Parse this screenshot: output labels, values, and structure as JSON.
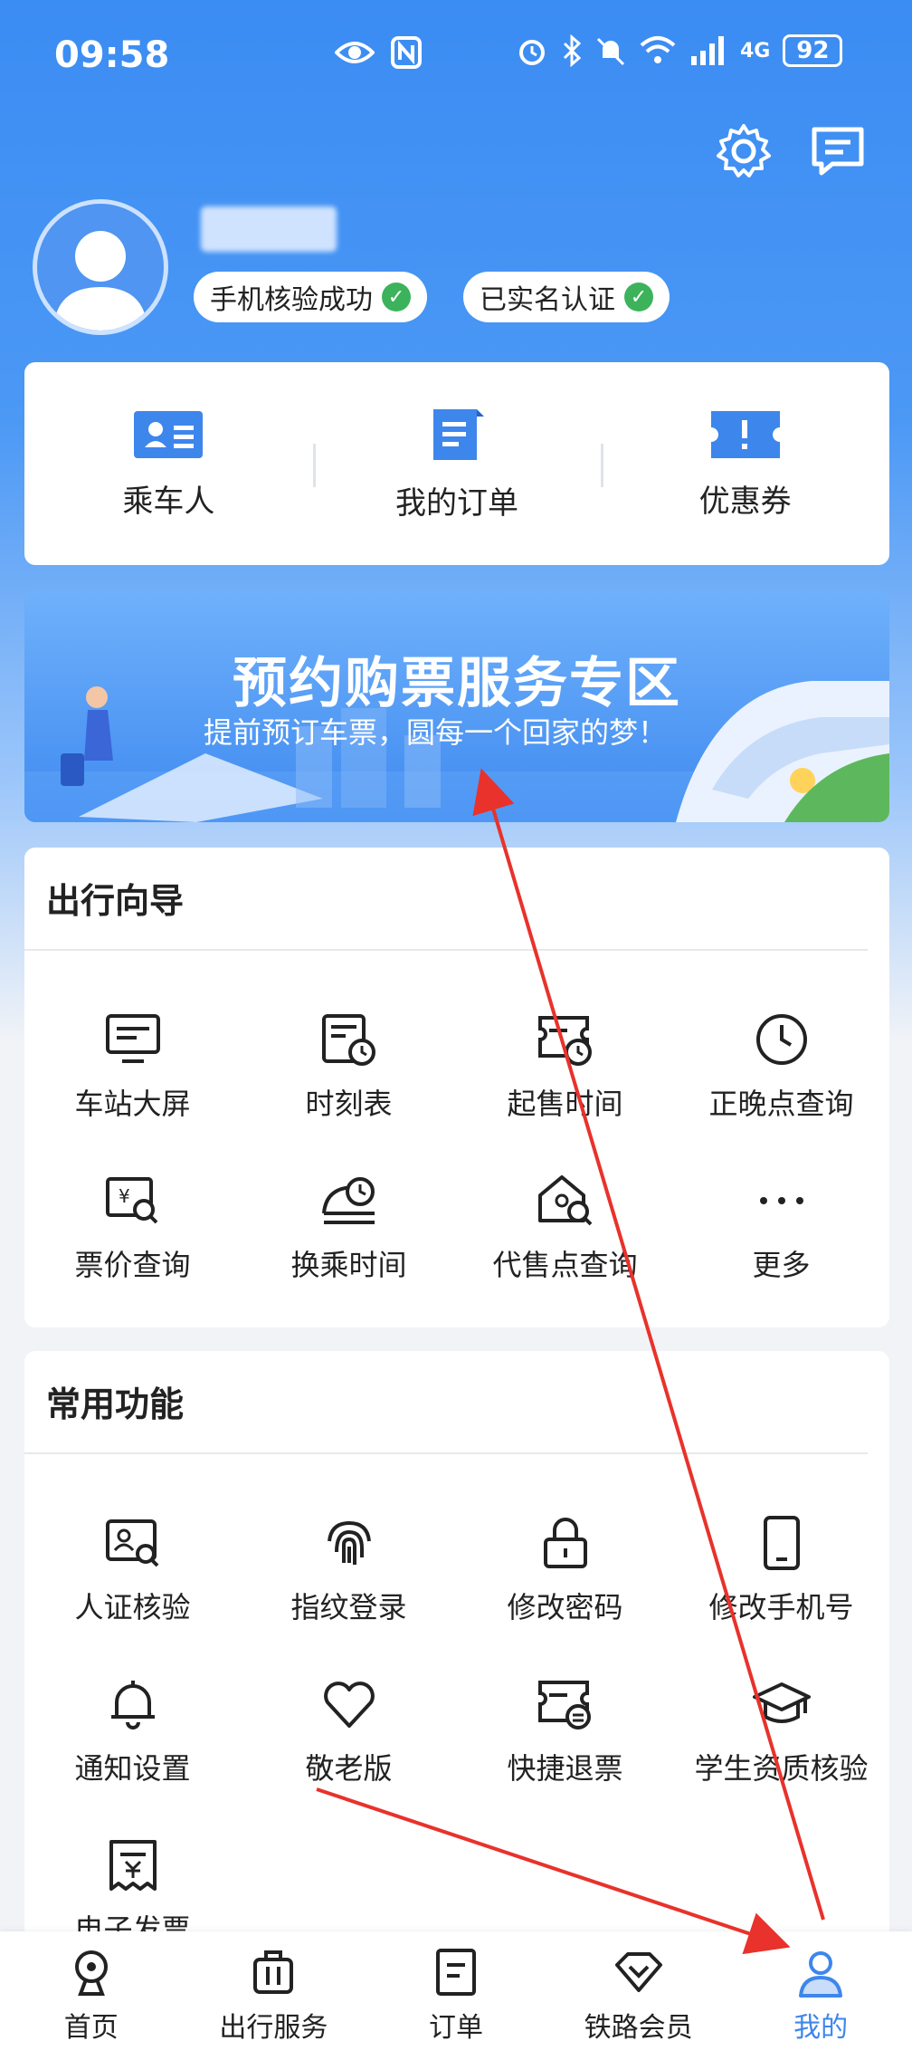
{
  "status_bar": {
    "time": "09:58",
    "battery": "92",
    "network": "4G"
  },
  "profile": {
    "badge_phone": "手机核验成功",
    "badge_realname": "已实名认证"
  },
  "quick": [
    {
      "label": "乘车人",
      "icon": "id-card-icon"
    },
    {
      "label": "我的订单",
      "icon": "document-icon"
    },
    {
      "label": "优惠券",
      "icon": "coupon-icon"
    }
  ],
  "banner": {
    "title": "预约购票服务专区",
    "subtitle": "提前预订车票，圆每一个回家的梦！"
  },
  "travel_guide": {
    "title": "出行向导",
    "items": [
      {
        "label": "车站大屏",
        "icon": "monitor-icon"
      },
      {
        "label": "时刻表",
        "icon": "timetable-icon"
      },
      {
        "label": "起售时间",
        "icon": "ticket-clock-icon"
      },
      {
        "label": "正晚点查询",
        "icon": "clock-icon"
      },
      {
        "label": "票价查询",
        "icon": "price-search-icon"
      },
      {
        "label": "换乘时间",
        "icon": "train-clock-icon"
      },
      {
        "label": "代售点查询",
        "icon": "house-search-icon"
      },
      {
        "label": "更多",
        "icon": "more-icon"
      }
    ]
  },
  "common_functions": {
    "title": "常用功能",
    "items": [
      {
        "label": "人证核验",
        "icon": "id-verify-icon"
      },
      {
        "label": "指纹登录",
        "icon": "fingerprint-icon"
      },
      {
        "label": "修改密码",
        "icon": "lock-icon"
      },
      {
        "label": "修改手机号",
        "icon": "phone-icon"
      },
      {
        "label": "通知设置",
        "icon": "bell-icon"
      },
      {
        "label": "敬老版",
        "icon": "heart-icon"
      },
      {
        "label": "快捷退票",
        "icon": "refund-ticket-icon"
      },
      {
        "label": "学生资质核验",
        "icon": "graduation-cap-icon"
      },
      {
        "label": "电子发票",
        "icon": "invoice-icon"
      }
    ]
  },
  "tabbar": [
    {
      "label": "首页",
      "icon": "home-icon"
    },
    {
      "label": "出行服务",
      "icon": "luggage-icon"
    },
    {
      "label": "订单",
      "icon": "order-icon"
    },
    {
      "label": "铁路会员",
      "icon": "diamond-icon"
    },
    {
      "label": "我的",
      "icon": "user-icon",
      "active": true
    }
  ],
  "colors": {
    "primary": "#3d86ec",
    "success": "#3cb35b",
    "annotation_arrow": "#e8322b"
  }
}
